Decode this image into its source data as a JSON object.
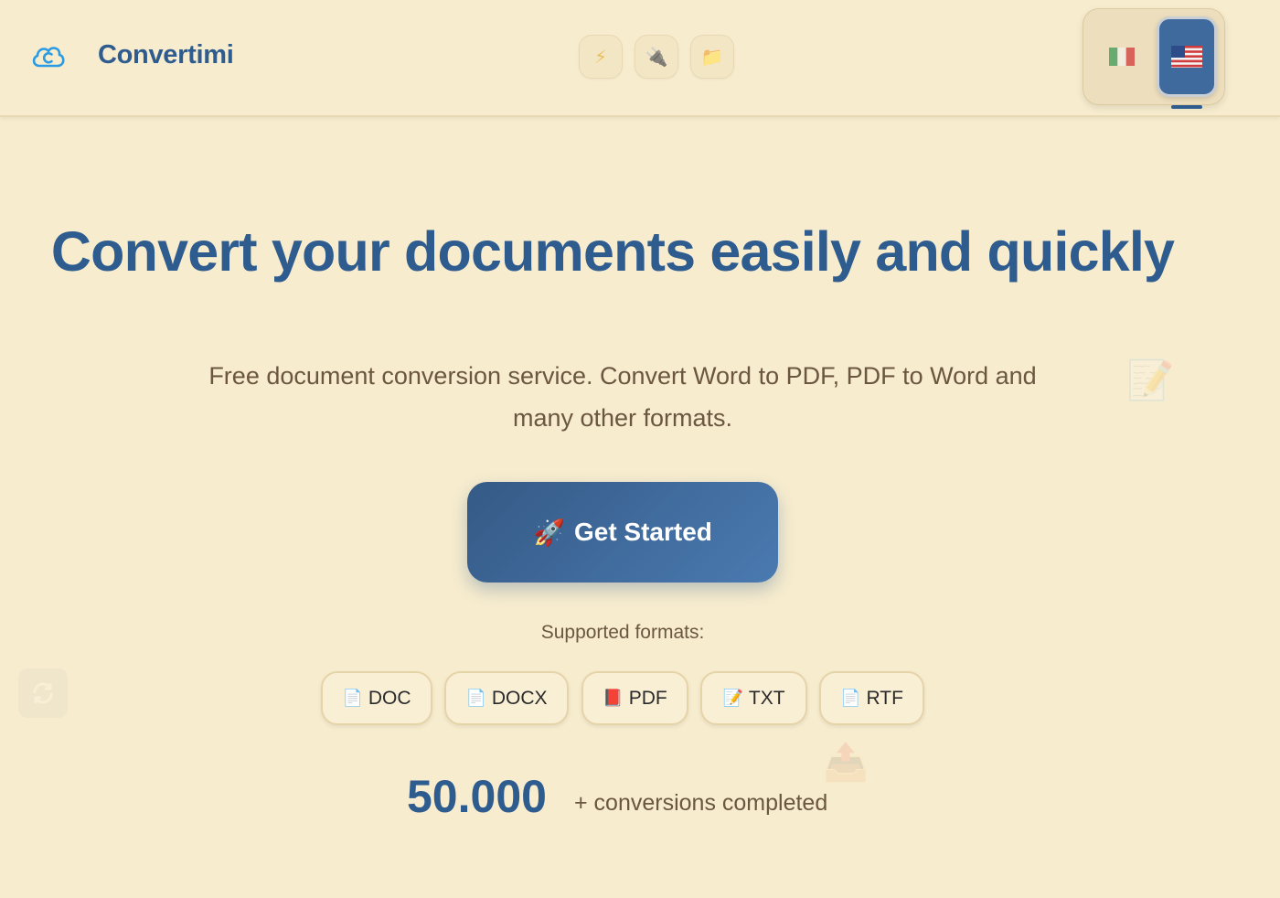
{
  "header": {
    "brand": "Convertimi",
    "tools": [
      {
        "icon": "lightning-icon",
        "glyph": "⚡"
      },
      {
        "icon": "plug-icon",
        "glyph": "🔌"
      },
      {
        "icon": "folder-icon",
        "glyph": "📁"
      }
    ],
    "languages": [
      {
        "code": "it",
        "icon": "italy-flag-icon",
        "active": false
      },
      {
        "code": "en",
        "icon": "usa-flag-icon",
        "active": true
      }
    ]
  },
  "hero": {
    "title": "Convert your documents easily and quickly",
    "subtitle": "Free document conversion service. Convert Word to PDF, PDF to Word and many other formats.",
    "cta": {
      "emoji": "🚀",
      "label": "Get Started"
    },
    "formats_label": "Supported formats:",
    "formats": [
      {
        "icon": "document-icon",
        "glyph": "📄",
        "label": "DOC"
      },
      {
        "icon": "document-icon",
        "glyph": "📄",
        "label": "DOCX"
      },
      {
        "icon": "book-icon",
        "glyph": "📕",
        "label": "PDF"
      },
      {
        "icon": "memo-icon",
        "glyph": "📝",
        "label": "TXT"
      },
      {
        "icon": "document-icon",
        "glyph": "📄",
        "label": "RTF"
      }
    ],
    "stat": {
      "value": "50.000",
      "label": "+ conversions completed"
    }
  },
  "colors": {
    "background": "#f7ecce",
    "primary": "#2f5c8f",
    "text_muted": "#6b5640"
  }
}
